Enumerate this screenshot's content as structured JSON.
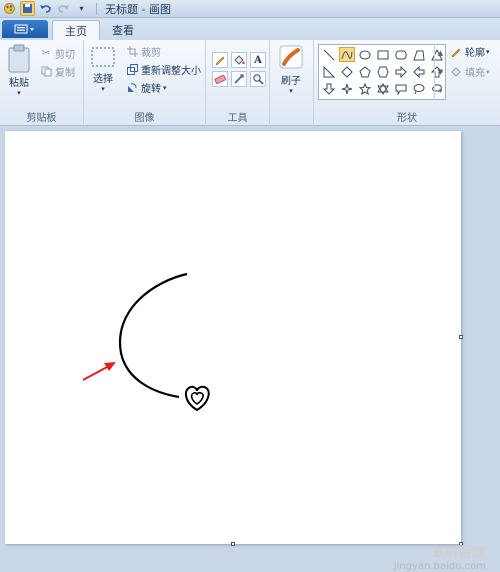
{
  "titlebar": {
    "title": "无标题 - 画图"
  },
  "tabs": [
    {
      "label": "主页"
    },
    {
      "label": "查看"
    }
  ],
  "clipboard": {
    "paste": "粘贴",
    "cut": "剪切",
    "copy": "复制",
    "group": "剪贴板"
  },
  "image": {
    "select": "选择",
    "crop": "裁剪",
    "resize": "重新调整大小",
    "rotate": "旋转",
    "group": "图像"
  },
  "tools": {
    "group": "工具"
  },
  "brushes": {
    "label": "刷子"
  },
  "shapes": {
    "outline": "轮廓",
    "fill": "填充",
    "group": "形状"
  },
  "watermark": {
    "text": "Bai百度",
    "url": "jingyan.baidu.com"
  },
  "colors": {
    "arrow": "#e02020",
    "stroke": "#000000"
  }
}
